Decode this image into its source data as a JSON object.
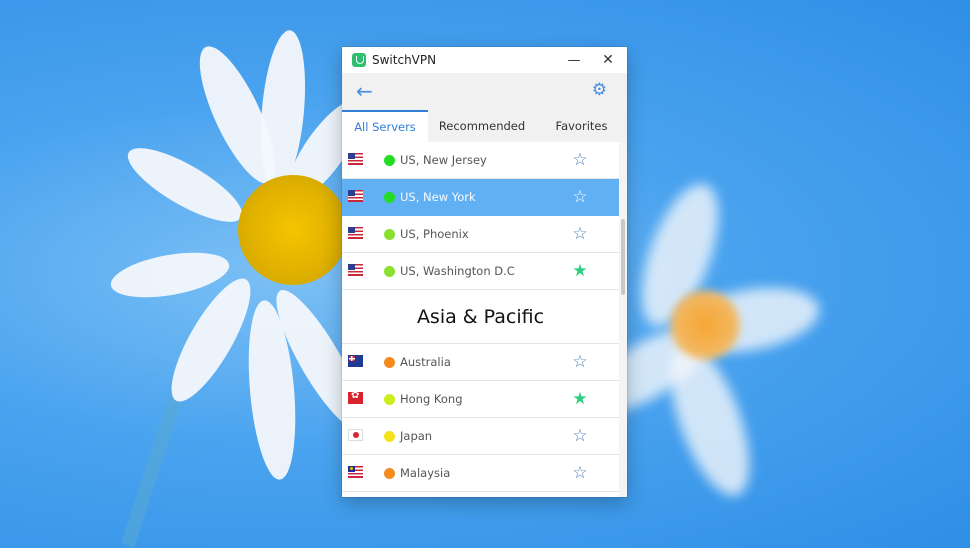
{
  "window": {
    "title": "SwitchVPN"
  },
  "toolbar": {
    "back_icon": "back-arrow-icon",
    "settings_icon": "gear-icon"
  },
  "tabs": [
    {
      "label": "All Servers",
      "active": true
    },
    {
      "label": "Recommended",
      "active": false
    },
    {
      "label": "Favorites",
      "active": false
    }
  ],
  "servers_us": [
    {
      "name": "US, New Jersey",
      "status_color": "#22dd22",
      "favorite": false,
      "selected": false
    },
    {
      "name": "US, New York",
      "status_color": "#22dd22",
      "favorite": false,
      "selected": true
    },
    {
      "name": "US, Phoenix",
      "status_color": "#88e030",
      "favorite": false,
      "selected": false
    },
    {
      "name": "US, Washington D.C",
      "status_color": "#88e030",
      "favorite": true,
      "selected": false
    }
  ],
  "section_asia": {
    "title": "Asia & Pacific"
  },
  "servers_asia": [
    {
      "name": "Australia",
      "status_color": "#f58a1f",
      "favorite": false,
      "flag": "au"
    },
    {
      "name": "Hong Kong",
      "status_color": "#c8ef1a",
      "favorite": true,
      "flag": "hk"
    },
    {
      "name": "Japan",
      "status_color": "#f4e21a",
      "favorite": false,
      "flag": "jp"
    },
    {
      "name": "Malaysia",
      "status_color": "#f58a1f",
      "favorite": false,
      "flag": "my"
    }
  ],
  "colors": {
    "accent": "#2f7fd6",
    "selected_row": "#62b0f4",
    "favorite_star": "#2fd084"
  }
}
